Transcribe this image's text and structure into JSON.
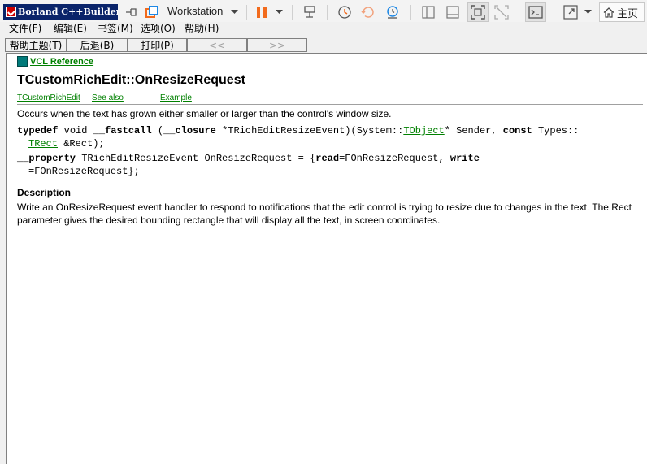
{
  "app": {
    "title": "Borland C++Builder",
    "icon": "borland-logo-icon"
  },
  "vm_toolbar": {
    "workstation_label": "Workstation",
    "home_tab_label": "主页",
    "colors": {
      "pause": "#f26b1d",
      "library": "#1e88e5"
    }
  },
  "menu": {
    "items": [
      "文件(F)",
      "编辑(E)",
      "书签(M)",
      "选项(O)",
      "帮助(H)"
    ]
  },
  "help_buttons": {
    "contents": "帮助主题(T)",
    "back": "后退(B)",
    "print": "打印(P)",
    "prev": "<<",
    "next": ">>"
  },
  "topic": {
    "vcl_reference": "VCL Reference",
    "title": "TCustomRichEdit::OnResizeRequest",
    "links": [
      "TCustomRichEdit",
      "See also",
      "Example"
    ],
    "summary": "Occurs when the text has grown either smaller or larger than the control's window size.",
    "code": {
      "line1": {
        "kw1": "typedef",
        "t1": " void ",
        "kw2": "__fastcall",
        "t2": " (",
        "kw3": "__closure",
        "t3": " *TRichEditResizeEvent)(System::",
        "link1": "TObject",
        "t4": "* Sender, ",
        "kw4": "const",
        "t5": " Types::"
      },
      "line2": {
        "link2": "TRect",
        "t6": " &Rect);"
      },
      "line3": {
        "kw5": "__property",
        "t7": " TRichEditResizeEvent OnResizeRequest = {",
        "kw6": "read",
        "t8": "=FOnResizeRequest, ",
        "kw7": "write"
      },
      "line4": {
        "t9": "=FOnResizeRequest};"
      }
    },
    "description_heading": "Description",
    "description_body": "Write an OnResizeRequest event handler to respond to notifications that the edit control is trying to resize due to changes in the text. The Rect parameter gives the desired bounding rectangle that will display all the text, in screen coordinates.",
    "colors": {
      "link": "#008000",
      "book": "#007a7a"
    }
  }
}
